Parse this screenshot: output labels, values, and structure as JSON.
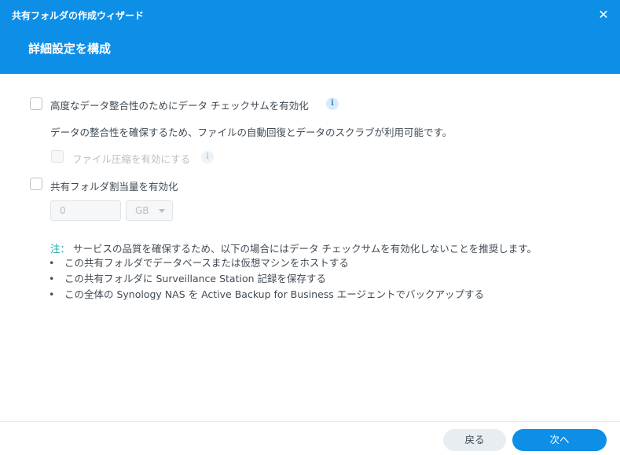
{
  "window": {
    "title": "共有フォルダの作成ウィザード"
  },
  "step": {
    "title": "詳細設定を構成"
  },
  "checksum": {
    "label": "高度なデータ整合性のためにデータ チェックサムを有効化",
    "info": "i",
    "checked": false,
    "description": "データの整合性を確保するため、ファイルの自動回復とデータのスクラブが利用可能です。"
  },
  "compression": {
    "label": "ファイル圧縮を有効にする",
    "info": "i",
    "checked": false,
    "disabled": true
  },
  "quota": {
    "label": "共有フォルダ割当量を有効化",
    "checked": false,
    "value": "0",
    "unit": "GB"
  },
  "note": {
    "label": "注：",
    "text": "サービスの品質を確保するため、以下の場合にはデータ チェックサムを有効化しないことを推奨します。",
    "items": [
      "この共有フォルダでデータベースまたは仮想マシンをホストする",
      "この共有フォルダに Surveillance Station 記録を保存する",
      "この全体の Synology NAS を Active Backup for Business エージェントでバックアップする"
    ]
  },
  "footer": {
    "back_label": "戻る",
    "next_label": "次へ"
  },
  "colors": {
    "accent": "#0d8fe8",
    "note": "#1aa5a5"
  }
}
